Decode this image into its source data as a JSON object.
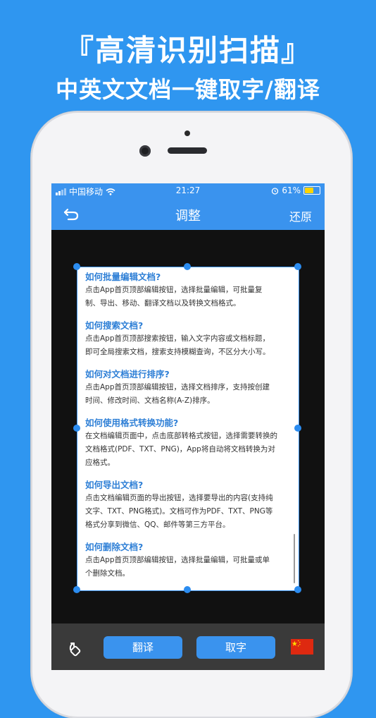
{
  "promo": {
    "title": "『高清识别扫描』",
    "subtitle": "中英文文档一键取字/翻译"
  },
  "status_bar": {
    "carrier": "中国移动",
    "time": "21:27",
    "battery": "61%",
    "battery_level": 0.61
  },
  "nav": {
    "title": "调整",
    "right_action": "还原",
    "back_icon": "back-arrow-icon"
  },
  "document": {
    "items": [
      {
        "q": "如何批量编辑文档?",
        "a": [
          "点击App首页顶部编辑按钮，选择批量编辑，可批量复",
          "制、导出、移动、翻译文档以及转换文档格式。"
        ]
      },
      {
        "q": "如何搜索文档?",
        "a": [
          "点击App首页顶部搜索按钮，输入文字内容或文档标题，",
          "即可全局搜索文档，搜索支持模糊查询，不区分大小写。"
        ]
      },
      {
        "q": "如何对文档进行排序?",
        "a": [
          "点击App首页顶部编辑按钮，选择文档排序，支持按创建",
          "时间、修改时间、文档名称(A-Z)排序。"
        ]
      },
      {
        "q": "如何使用格式转换功能?",
        "a": [
          "在文档编辑页面中，点击底部转格式按钮，选择需要转换的",
          "文档格式(PDF、TXT、PNG)，App将自动将文档转换为对",
          "应格式。"
        ]
      },
      {
        "q": "如何导出文档?",
        "a": [
          "点击文档编辑页面的导出按钮，选择要导出的内容(支持纯",
          "文字、TXT、PNG格式)。文档可作为PDF、TXT、PNG等",
          "格式分享到微信、QQ、邮件等第三方平台。"
        ]
      },
      {
        "q": "如何删除文档?",
        "a": [
          "点击App首页顶部编辑按钮，选择批量编辑，可批量或单",
          "个删除文档。"
        ]
      }
    ]
  },
  "bottom_bar": {
    "translate_label": "翻译",
    "extract_label": "取字",
    "rotate_icon": "rotate-icon",
    "flag_icon": "china-flag-icon"
  },
  "colors": {
    "background": "#2f96f0",
    "nav": "#3a93ee",
    "accent": "#2e7fd6"
  }
}
